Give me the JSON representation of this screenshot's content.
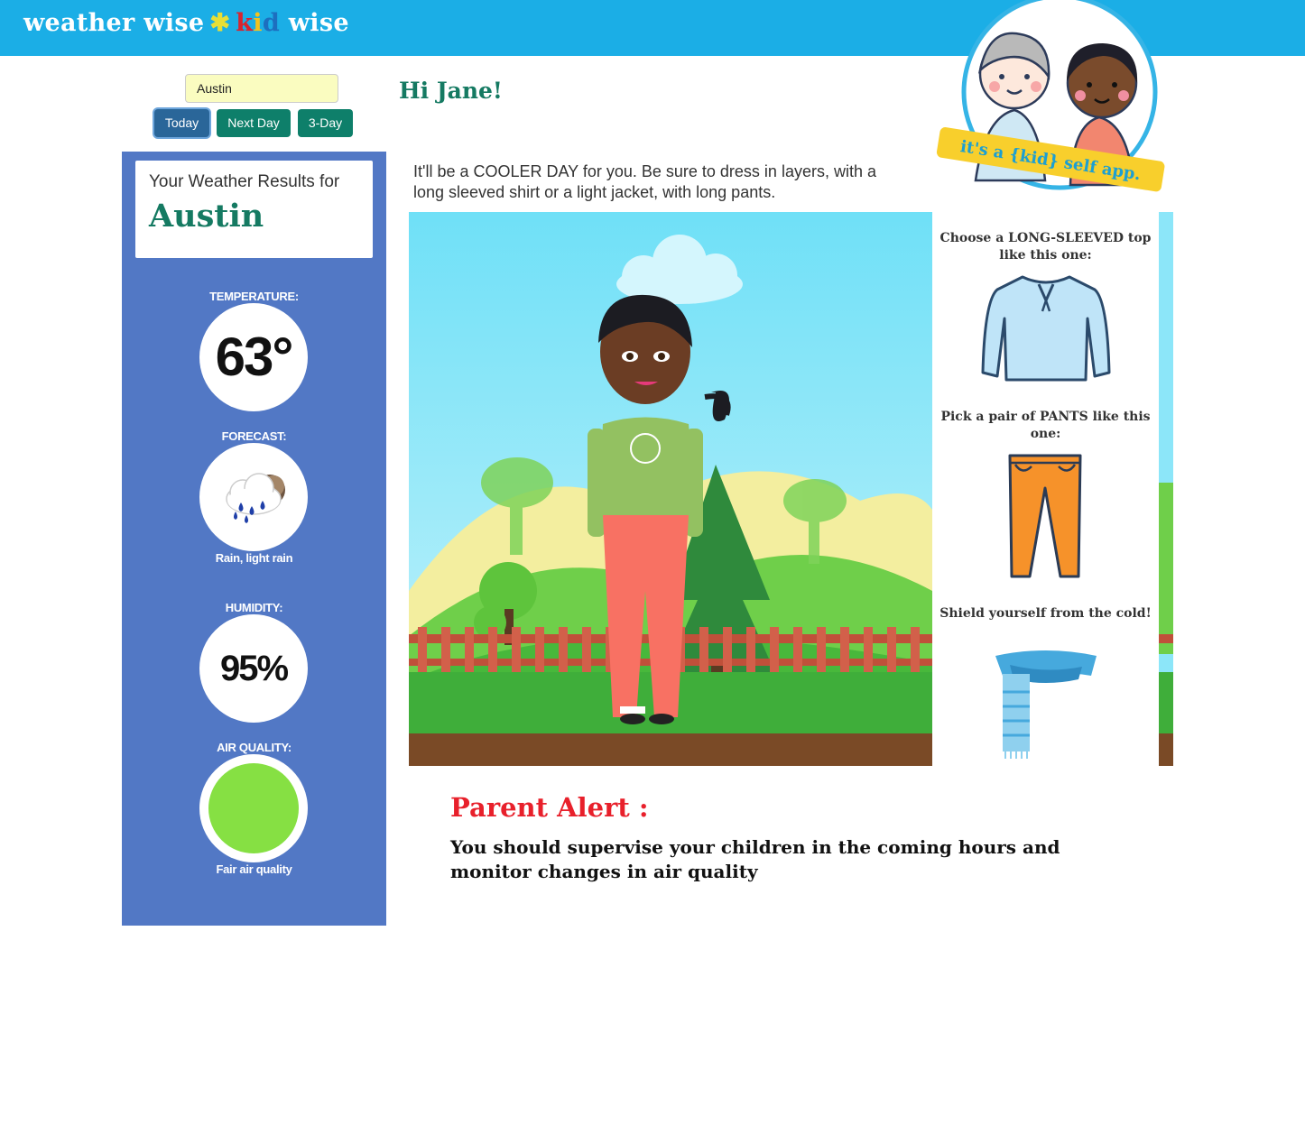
{
  "header": {
    "brand_part1": "weather wise",
    "brand_star": "✱",
    "brand_k": "k",
    "brand_i": "i",
    "brand_d": "d",
    "brand_part2": "wise",
    "badge_text": "it's a {kid} self app."
  },
  "search": {
    "value": "Austin"
  },
  "day_buttons": {
    "today": "Today",
    "next_day": "Next Day",
    "three_day": "3-Day",
    "active": "today"
  },
  "sidebar": {
    "results_label": "Your Weather Results for",
    "city": "Austin",
    "temperature": {
      "label": "TEMPERATURE:",
      "value": "63°"
    },
    "forecast": {
      "label": "FORECAST:",
      "caption": "Rain, light rain",
      "icon": "rain-cloud-icon"
    },
    "humidity": {
      "label": "HUMIDITY:",
      "value": "95%"
    },
    "air_quality": {
      "label": "AIR QUALITY:",
      "caption": "Fair air quality",
      "color": "#86e043"
    }
  },
  "main": {
    "greeting": "Hi Jane!",
    "advice": "It'll be a COOLER DAY for you. Be sure to dress in layers, with a long sleeved shirt or a light jacket, with long pants."
  },
  "clothing": {
    "top_heading": "Choose a LONG-SLEEVED top like this one:",
    "pants_heading": "Pick a pair of PANTS like this one:",
    "accessory_heading": "Shield yourself from the cold!"
  },
  "alert": {
    "title": "Parent Alert :",
    "body": "You should supervise your children in the coming hours and monitor changes in air quality"
  },
  "colors": {
    "header": "#1baee6",
    "sidebar": "#5278c5",
    "accent_green": "#157a62",
    "alert_red": "#e8202b"
  }
}
